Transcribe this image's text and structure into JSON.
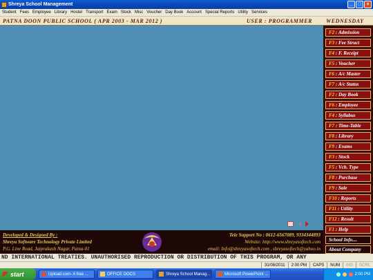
{
  "window": {
    "title": "Shreya School Management"
  },
  "menu": [
    "Student",
    "Fees",
    "Employee",
    "Library",
    "Hostel",
    "Transport",
    "Exam",
    "Stock",
    "Misc",
    "Voucher",
    "Day Book",
    "Account",
    "Special Reports",
    "Utility",
    "Services"
  ],
  "header": {
    "school": "PATNA DOON PUBLIC SCHOOL ( APR 2003 - MAR 2012 )",
    "user": "USER : PROGRAMMER",
    "day": "WEDNESDAY"
  },
  "sidebar": [
    {
      "key": "F2",
      "label": "Admission"
    },
    {
      "key": "F3",
      "label": "Fee Struct"
    },
    {
      "key": "F4",
      "label": "F. Receipt"
    },
    {
      "key": "F5",
      "label": "Voucher"
    },
    {
      "key": "F6",
      "label": "A/c Master"
    },
    {
      "key": "F7",
      "label": "A/c Status"
    },
    {
      "key": "F2",
      "label": "Day Book"
    },
    {
      "key": "F6",
      "label": "Employee"
    },
    {
      "key": "F4",
      "label": "Syllabus"
    },
    {
      "key": "F7",
      "label": "Time-Table"
    },
    {
      "key": "F8",
      "label": "Library"
    },
    {
      "key": "F9",
      "label": "Exams"
    },
    {
      "key": "F3",
      "label": "Stock"
    },
    {
      "key": "F5",
      "label": "Vch. Type"
    },
    {
      "key": "F8",
      "label": "Purchase"
    },
    {
      "key": "F9",
      "label": "Sale"
    },
    {
      "key": "F10",
      "label": "Reports"
    },
    {
      "key": "F11",
      "label": "Utility"
    },
    {
      "key": "F12",
      "label": "Result"
    },
    {
      "key": "F1",
      "label": "Help"
    },
    {
      "key": "",
      "label": "School Info...."
    },
    {
      "key": "",
      "label": "About Company"
    }
  ],
  "footer": {
    "developed": "Developed & Designed By :",
    "company": "Shreya Software Technology Private Limited",
    "address": "P.G. Line Road, Jaiprakash Nagar, Patna-01",
    "support": "Tele Support No : 0612-6567089, 9334344893",
    "website": "Website: http://www.shreyasoftech.com",
    "email": "email: Info@shreyasoftech.com , shreyasoftech@yahoo.in"
  },
  "ticker": "ND INTERNATIONAL TREATIES. UNAUTHORISED REPRODUCTION OR DISTRIBUTION OF THIS PROGRAM, OR ANY",
  "status": {
    "date": "31/08/2011",
    "time": "2:00 PM",
    "caps": "CAPS",
    "num": "NUM",
    "ins": "INS",
    "scrl": "SCRL"
  },
  "taskbar": {
    "start": "start",
    "tasks": [
      "Upload.com- A free ...",
      "OFFICE DOCS",
      "Shreya School Manag...",
      "Microsoft PowerPoint ..."
    ],
    "clock": "2:00 PM"
  },
  "colors": {
    "workspace": "#4f8fb4",
    "sidebar_bg": "#3d0a0a",
    "button": "#8a1010",
    "header_bg": "#efe6c6"
  }
}
